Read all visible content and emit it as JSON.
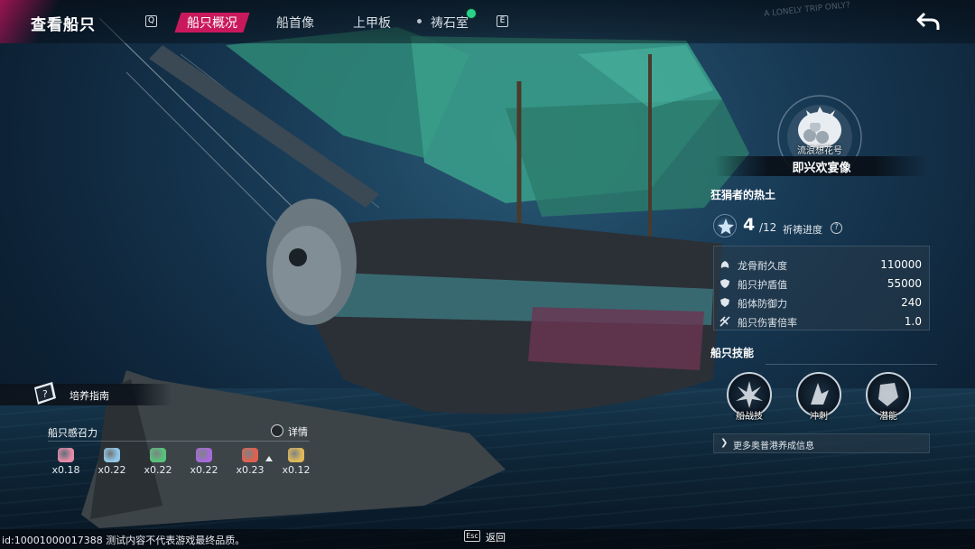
{
  "header": {
    "title": "查看船只",
    "key_prev": "Q",
    "key_next": "E",
    "tabs": [
      {
        "label": "船只概况",
        "active": true
      },
      {
        "label": "船首像",
        "active": false
      },
      {
        "label": "上甲板",
        "active": false
      },
      {
        "label": "祷石室",
        "active": false
      }
    ],
    "background_note": "A LONELY TRIP ONLY?"
  },
  "figurehead": {
    "caption": "流浪想花号",
    "name": "即兴欢宴像"
  },
  "ship": {
    "subtitle": "狂狷者的热土",
    "prayer_progress": {
      "current": "4",
      "max": "/12",
      "label": "祈祷进度",
      "help": "?"
    },
    "stats": [
      {
        "icon": "dragon-bone-icon",
        "label": "龙骨耐久度",
        "value": "110000"
      },
      {
        "icon": "shield-icon",
        "label": "船只护盾值",
        "value": "55000"
      },
      {
        "icon": "hull-defense-icon",
        "label": "船体防御力",
        "value": "240"
      },
      {
        "icon": "damage-multiplier-icon",
        "label": "船只伤害倍率",
        "value": "1.0"
      }
    ]
  },
  "skills": {
    "title": "船只技能",
    "items": [
      {
        "icon": "naval-combat-icon",
        "label": "船战技"
      },
      {
        "icon": "dash-icon",
        "label": "冲刺"
      },
      {
        "icon": "dive-icon",
        "label": "潜能"
      }
    ],
    "more_info": "更多奥普港养成信息"
  },
  "left_panel": {
    "guide_label": "培养指南",
    "summon_title": "船只感召力",
    "detail_label": "详情",
    "summon_items": [
      {
        "icon": "pink-ore-icon",
        "color": "#e58aa6",
        "value": "x0.18"
      },
      {
        "icon": "blue-shell-icon",
        "color": "#8fc6e6",
        "value": "x0.22"
      },
      {
        "icon": "green-leaf-icon",
        "color": "#58c27a",
        "value": "x0.22"
      },
      {
        "icon": "purple-crystal-icon",
        "color": "#a66ad9",
        "value": "x0.22"
      },
      {
        "icon": "red-flame-icon",
        "color": "#e0604f",
        "value": "x0.23"
      },
      {
        "icon": "gold-pouch-icon",
        "color": "#e0b85a",
        "value": "x0.12"
      }
    ]
  },
  "footer": {
    "build_id": "id:10001000017388  测试内容不代表游戏最终品质。",
    "esc_key": "Esc",
    "esc_label": "返回"
  },
  "colors": {
    "accent": "#c9195c",
    "panel_bg": "#283a4a",
    "sail": "#2f8a78"
  }
}
